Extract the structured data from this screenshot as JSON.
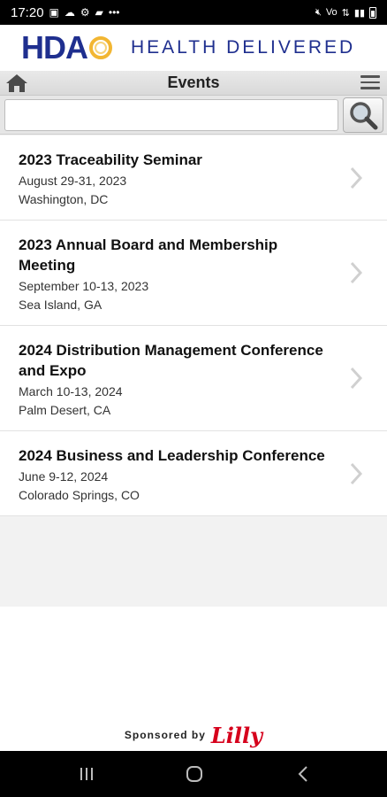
{
  "status_bar": {
    "time": "17:20",
    "left_icons": [
      "photo-icon",
      "cloud-icon",
      "settings-icon",
      "message-icon",
      "more-dots-icon"
    ],
    "right_icons": [
      "mute-icon",
      "volte-icon",
      "wifi-icon",
      "signal-icon",
      "battery-icon"
    ]
  },
  "brand": {
    "logo_text": "HDA",
    "tagline": "HEALTH DELIVERED",
    "primary_color": "#1f2f8f",
    "accent_color": "#f2b632"
  },
  "nav": {
    "title": "Events",
    "home_icon": "home-icon",
    "menu_icon": "hamburger-icon"
  },
  "search": {
    "value": "",
    "placeholder": "",
    "button_icon": "search-icon"
  },
  "events": [
    {
      "title": "2023 Traceability Seminar",
      "date": "August 29-31, 2023",
      "location": "Washington, DC"
    },
    {
      "title": "2023 Annual Board and Membership Meeting",
      "date": "September 10-13, 2023",
      "location": "Sea Island, GA"
    },
    {
      "title": "2024 Distribution Management Conference and Expo",
      "date": "March 10-13, 2024",
      "location": "Palm Desert, CA"
    },
    {
      "title": "2024 Business and Leadership Conference",
      "date": "June 9-12, 2024",
      "location": "Colorado Springs, CO"
    }
  ],
  "sponsor": {
    "label": "Sponsored by",
    "logo_text": "Lilly",
    "logo_color": "#d6001c"
  },
  "system_nav": [
    "recents-icon",
    "home-circle-icon",
    "back-icon"
  ]
}
